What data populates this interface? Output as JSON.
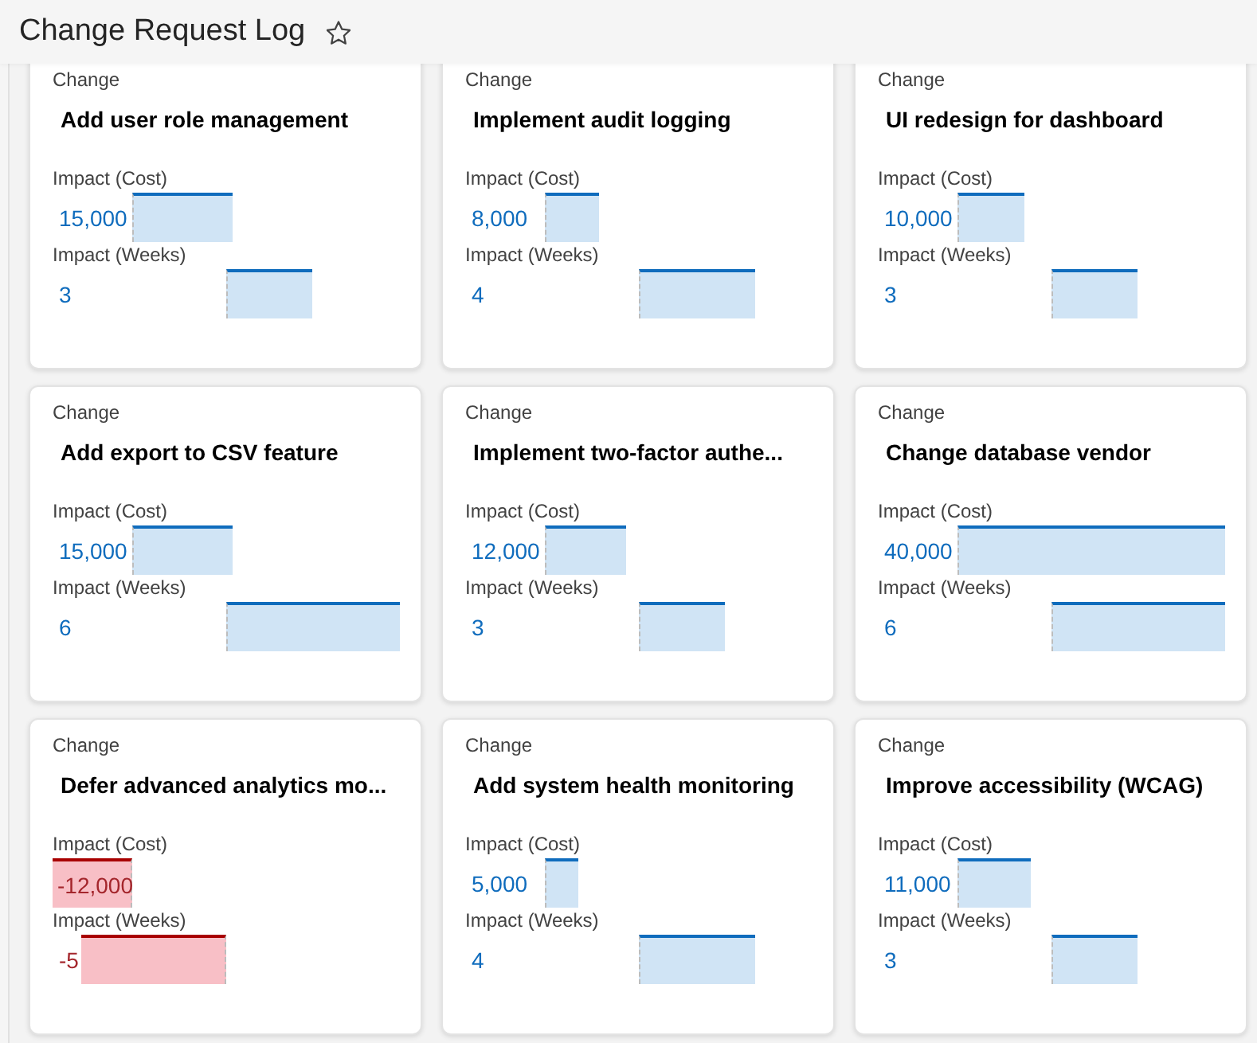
{
  "header": {
    "title": "Change Request Log"
  },
  "cards": [
    {
      "type_label": "Change",
      "title": "Add user role management",
      "metrics": [
        {
          "kind": "cost",
          "label": "Impact (Cost)",
          "value": "15,000"
        },
        {
          "kind": "weeks",
          "label": "Impact (Weeks)",
          "value": "3"
        }
      ]
    },
    {
      "type_label": "Change",
      "title": "Implement audit logging",
      "metrics": [
        {
          "kind": "cost",
          "label": "Impact (Cost)",
          "value": "8,000"
        },
        {
          "kind": "weeks",
          "label": "Impact (Weeks)",
          "value": "4"
        }
      ]
    },
    {
      "type_label": "Change",
      "title": "UI redesign for dashboard",
      "metrics": [
        {
          "kind": "cost",
          "label": "Impact (Cost)",
          "value": "10,000"
        },
        {
          "kind": "weeks",
          "label": "Impact (Weeks)",
          "value": "3"
        }
      ]
    },
    {
      "type_label": "Change",
      "title": "Add export to CSV feature",
      "metrics": [
        {
          "kind": "cost",
          "label": "Impact (Cost)",
          "value": "15,000"
        },
        {
          "kind": "weeks",
          "label": "Impact (Weeks)",
          "value": "6"
        }
      ]
    },
    {
      "type_label": "Change",
      "title": "Implement two-factor authe...",
      "metrics": [
        {
          "kind": "cost",
          "label": "Impact (Cost)",
          "value": "12,000"
        },
        {
          "kind": "weeks",
          "label": "Impact (Weeks)",
          "value": "3"
        }
      ]
    },
    {
      "type_label": "Change",
      "title": "Change database vendor",
      "metrics": [
        {
          "kind": "cost",
          "label": "Impact (Cost)",
          "value": "40,000"
        },
        {
          "kind": "weeks",
          "label": "Impact (Weeks)",
          "value": "6"
        }
      ]
    },
    {
      "type_label": "Change",
      "title": "Defer advanced analytics mo...",
      "metrics": [
        {
          "kind": "cost",
          "label": "Impact (Cost)",
          "value": "-12,000"
        },
        {
          "kind": "weeks",
          "label": "Impact (Weeks)",
          "value": "-5"
        }
      ]
    },
    {
      "type_label": "Change",
      "title": "Add system health monitoring",
      "metrics": [
        {
          "kind": "cost",
          "label": "Impact (Cost)",
          "value": "5,000"
        },
        {
          "kind": "weeks",
          "label": "Impact (Weeks)",
          "value": "4"
        }
      ]
    },
    {
      "type_label": "Change",
      "title": "Improve accessibility (WCAG)",
      "metrics": [
        {
          "kind": "cost",
          "label": "Impact (Cost)",
          "value": "11,000"
        },
        {
          "kind": "weeks",
          "label": "Impact (Weeks)",
          "value": "3"
        }
      ]
    }
  ]
}
